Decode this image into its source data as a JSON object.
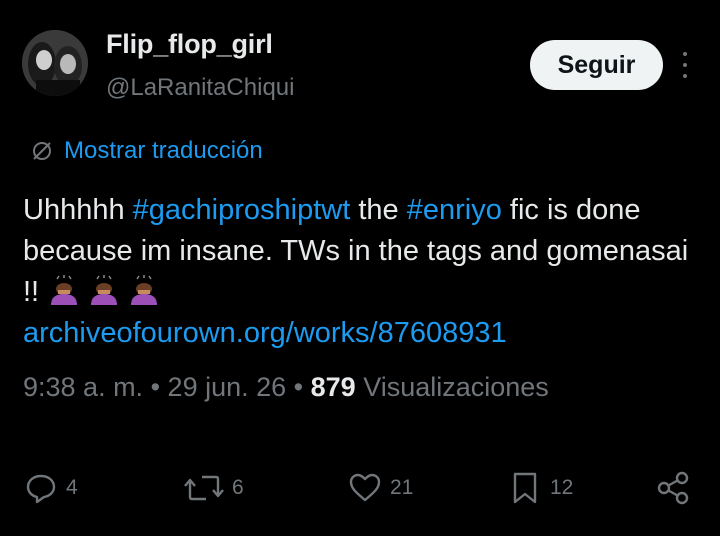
{
  "author": {
    "display_name": "Flip_flop_girl",
    "handle": "@LaRanitaChiqui",
    "follow_label": "Seguir"
  },
  "translate_label": "Mostrar traducción",
  "tweet": {
    "line1_a": "Uhhhhh ",
    "hashtag1": "#gachiproshiptwt",
    "line1_b": " the ",
    "hashtag2": "#enriyo",
    "line1_c": " fic is done because im insane. TWs in the tags and gomenasai !! ",
    "emoji_name": "person-bowing-emoji",
    "link": "archiveofourown.org/works/87608931"
  },
  "meta": {
    "time": "9:38 a. m.",
    "sep1": " • ",
    "date": "29 jun. 26",
    "sep2": " • ",
    "views_count": "879",
    "views_label": " Visualizaciones"
  },
  "actions": {
    "replies": "4",
    "reposts": "6",
    "likes": "21",
    "bookmarks": "12"
  },
  "colors": {
    "background": "#000000",
    "text": "#e7e9ea",
    "muted": "#71767b",
    "accent": "#1d9bf0",
    "button_bg": "#eff3f4"
  }
}
